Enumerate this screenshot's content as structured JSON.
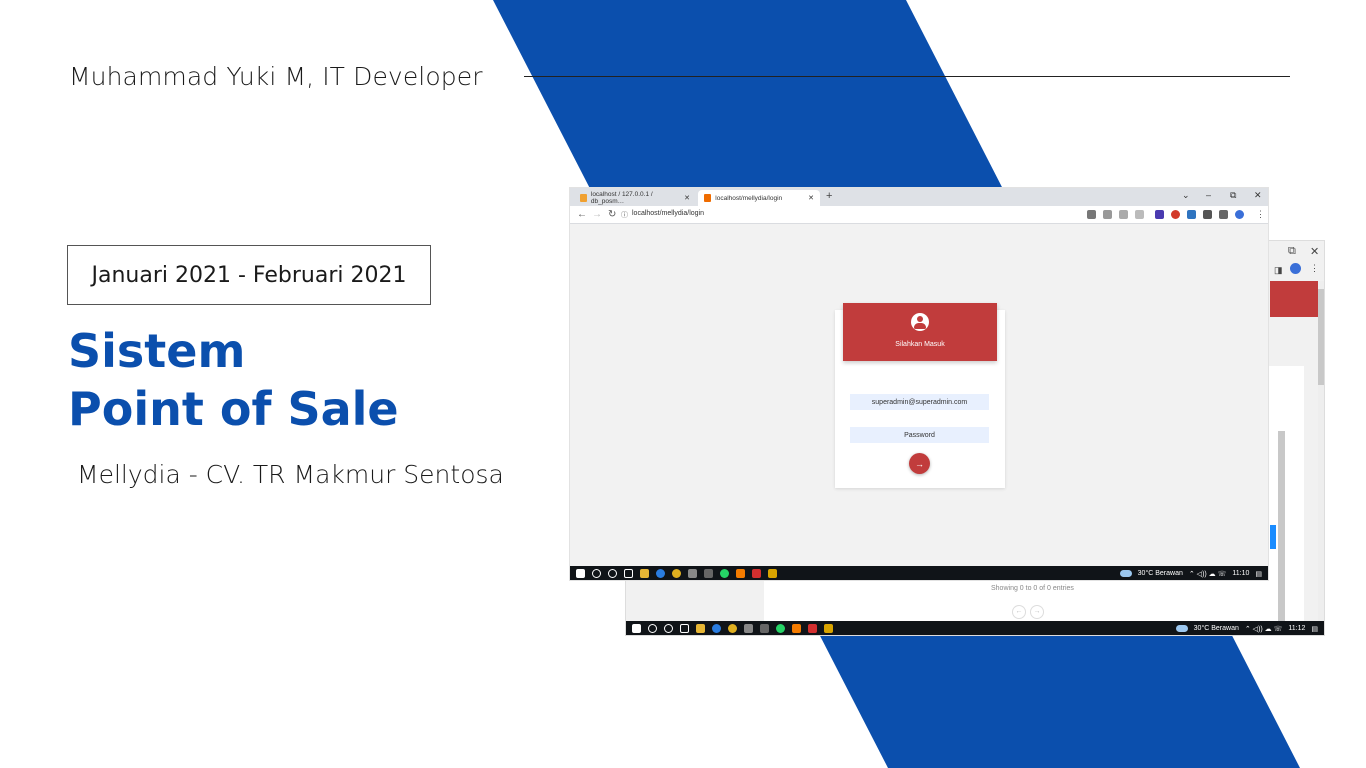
{
  "slide": {
    "author": "Muhammad Yuki M, IT Developer",
    "period": "Januari 2021 - Februari 2021",
    "title_line1": "Sistem",
    "title_line2": "Point of Sale",
    "client": "Mellydia - CV. TR Makmur Sentosa"
  },
  "colors": {
    "brand_blue": "#0b4fad",
    "login_red": "#c13c3c"
  },
  "browser": {
    "tabs": [
      {
        "label": "localhost / 127.0.0.1 / db_posm…",
        "icon": "phpmyadmin-icon"
      },
      {
        "label": "localhost/mellydia/login",
        "icon": "app-favicon-icon"
      }
    ],
    "new_tab": "+",
    "url": "localhost/mellydia/login",
    "win_minimize": "–",
    "win_restore": "⧉",
    "win_close": "✕",
    "tab_close": "✕"
  },
  "login": {
    "header": "Silahkan Masuk",
    "email_value": "superadmin@superadmin.com",
    "password_value": "Password",
    "submit_icon": "arrow-right-icon",
    "submit_glyph": "→"
  },
  "back_page": {
    "showing_text": "Showing 0 to 0 of 0 entries",
    "prev": "←",
    "next": "→"
  },
  "taskbar_front": {
    "weather": "30°C  Berawan",
    "time": "11:10"
  },
  "taskbar_back": {
    "weather": "30°C  Berawan",
    "time": "11:12"
  }
}
